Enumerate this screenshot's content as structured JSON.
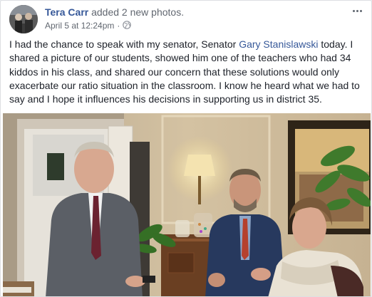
{
  "post": {
    "author": "Tera Carr",
    "action": "added 2 new photos.",
    "timestamp": "April 5 at 12:24pm",
    "privacy_icon": "globe-icon",
    "more_icon": "ellipsis-icon",
    "text_before_link": "I had the chance to speak with my senator, Senator ",
    "tagged_link": "Gary Stanislawski",
    "text_after_link": " today. I shared a picture of our students, showed him one of the teachers who had 34 kiddos in his class, and shared our concern that these solutions would only exacerbate our ratio situation in the classroom. I know he heard what we had to say and I hope it influences his decisions in supporting us in district 35."
  },
  "colors": {
    "link": "#365899",
    "meta": "#616770",
    "text": "#1d2129"
  }
}
